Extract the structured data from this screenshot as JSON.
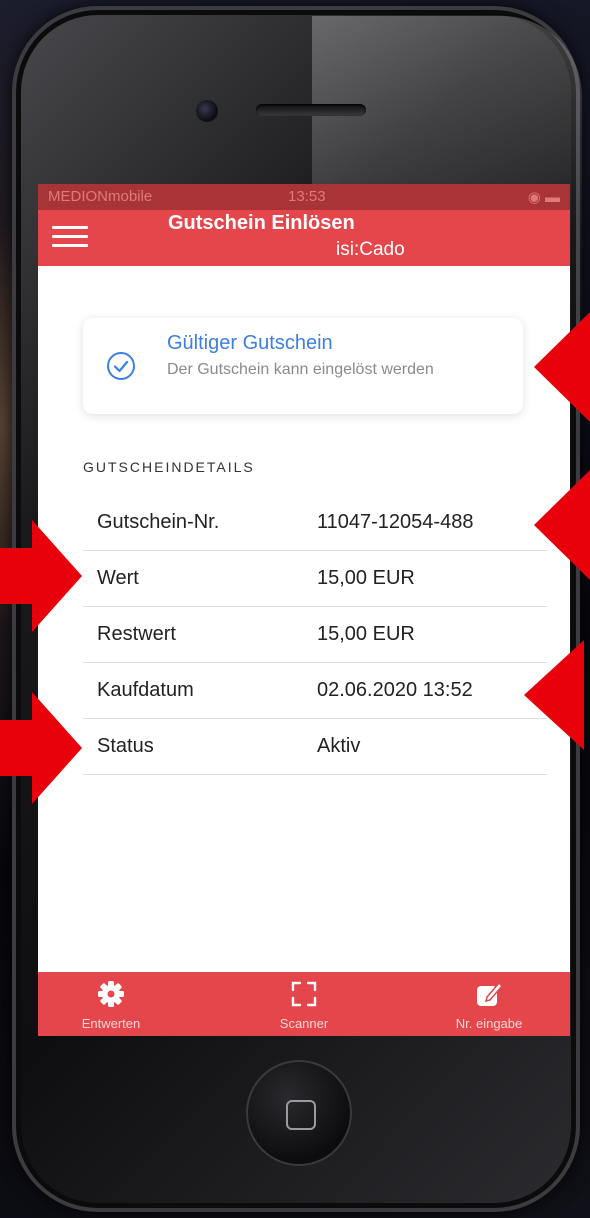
{
  "status_bar": {
    "carrier": "MEDIONmobile",
    "time": "13:53"
  },
  "app_bar": {
    "title": "Gutschein Einlösen",
    "subtitle": "isi:Cado",
    "menu_icon": "hamburger-menu-icon"
  },
  "validity_card": {
    "icon": "check-circle-icon",
    "title": "Gültiger Gutschein",
    "description": "Der Gutschein kann eingelöst werden"
  },
  "details": {
    "section_label": "GUTSCHEINDETAILS",
    "rows": [
      {
        "label": "Gutschein-Nr.",
        "value": "11047-12054-488"
      },
      {
        "label": "Wert",
        "value": "15,00 EUR"
      },
      {
        "label": "Restwert",
        "value": "15,00 EUR"
      },
      {
        "label": "Kaufdatum",
        "value": "02.06.2020 13:52"
      },
      {
        "label": "Status",
        "value": "Aktiv"
      }
    ]
  },
  "tab_bar": {
    "tabs": [
      {
        "label": "Entwerten",
        "icon": "gear-icon"
      },
      {
        "label": "Scanner",
        "icon": "scan-frame-icon"
      },
      {
        "label": "Nr. eingabe",
        "icon": "edit-icon"
      }
    ]
  },
  "colors": {
    "brand_red": "#e5464b",
    "accent_blue": "#3d7ee0",
    "annotation_arrow": "#e8000b"
  }
}
